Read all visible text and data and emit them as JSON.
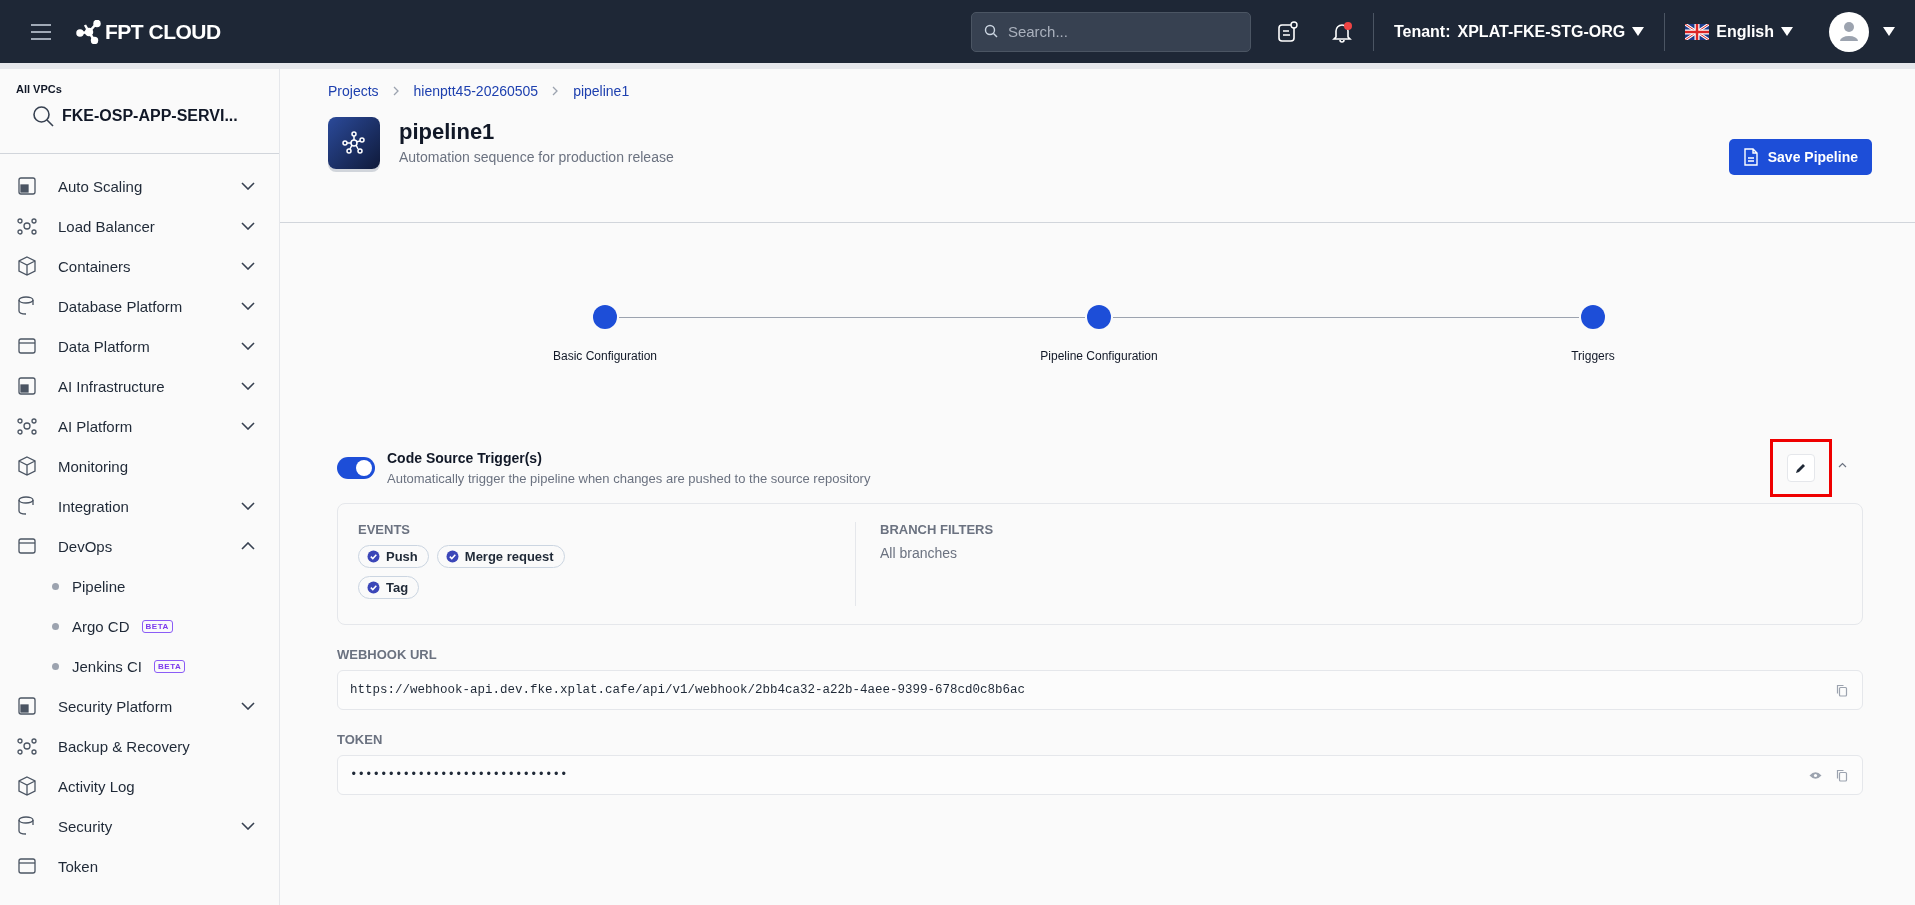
{
  "topbar": {
    "brand": "FPT CLOUD",
    "search": {
      "placeholder": "Search..."
    },
    "notification_unread": true,
    "tenant_label": "Tenant:",
    "tenant": "XPLAT-FKE-STG-ORG",
    "language": "English"
  },
  "sidebar": {
    "vpc_label": "All VPCs",
    "vpc": "FKE-OSP-APP-SERVI...",
    "items": [
      {
        "label": "Auto Scaling",
        "expanded": false
      },
      {
        "label": "Load Balancer",
        "expanded": false
      },
      {
        "label": "Containers",
        "expanded": false
      },
      {
        "label": "Database Platform",
        "expanded": false
      },
      {
        "label": "Data Platform",
        "expanded": false
      },
      {
        "label": "AI Infrastructure",
        "expanded": false
      },
      {
        "label": "AI Platform",
        "expanded": false
      },
      {
        "label": "Monitoring"
      },
      {
        "label": "Integration",
        "expanded": false
      },
      {
        "label": "DevOps",
        "expanded": true,
        "children": [
          {
            "label": "Pipeline"
          },
          {
            "label": "Argo CD",
            "badge": "BETA"
          },
          {
            "label": "Jenkins CI",
            "badge": "BETA"
          }
        ]
      },
      {
        "label": "Security Platform",
        "expanded": false
      },
      {
        "label": "Backup & Recovery"
      },
      {
        "label": "Activity Log"
      },
      {
        "label": "Security",
        "expanded": false
      },
      {
        "label": "Token"
      }
    ]
  },
  "breadcrumbs": [
    "Projects",
    "hienptt45-20260505",
    "pipeline1"
  ],
  "page": {
    "title": "pipeline1",
    "subtitle": "Automation sequence for production release",
    "save_button": "Save Pipeline"
  },
  "steps": [
    {
      "label": "Basic Configuration",
      "done": true
    },
    {
      "label": "Pipeline Configuration",
      "done": true
    },
    {
      "label": "Triggers",
      "done": true
    }
  ],
  "trigger": {
    "title": "Code Source Trigger(s)",
    "description": "Automatically trigger the pipeline when changes are pushed to the source repository",
    "on": true,
    "edit_highlighted": true,
    "expanded": true,
    "events_label": "EVENTS",
    "events": [
      "Push",
      "Merge request",
      "Tag"
    ],
    "branch_label": "BRANCH FILTERS",
    "branch_value": "All branches",
    "webhook_label": "WEBHOOK URL",
    "webhook_url": "https://webhook-api.dev.fke.xplat.cafe/api/v1/webhook/2bb4ca32-a22b-4aee-9399-678cd0c8b6ac",
    "token_label": "TOKEN",
    "token": "•••••••••••••••••••••••••••••"
  }
}
